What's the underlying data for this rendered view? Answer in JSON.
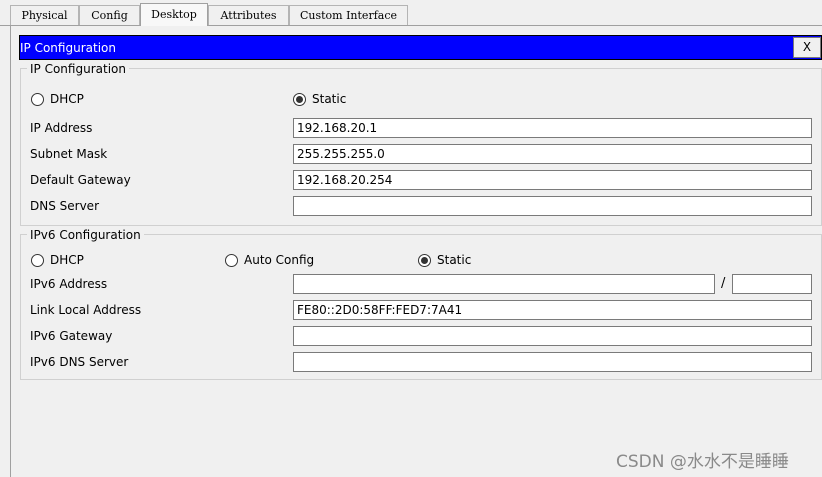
{
  "tabs": [
    {
      "label": "Physical"
    },
    {
      "label": "Config"
    },
    {
      "label": "Desktop",
      "active": true
    },
    {
      "label": "Attributes"
    },
    {
      "label": "Custom Interface"
    }
  ],
  "window": {
    "title": "IP Configuration",
    "close_label": "X",
    "titlebar_color": "#0000ff"
  },
  "ipv4": {
    "legend": "IP Configuration",
    "mode_dhcp": "DHCP",
    "mode_static": "Static",
    "selected_mode": "Static",
    "ip_label": "IP Address",
    "ip_value": "192.168.20.1",
    "mask_label": "Subnet Mask",
    "mask_value": "255.255.255.0",
    "gateway_label": "Default Gateway",
    "gateway_value": "192.168.20.254",
    "dns_label": "DNS Server",
    "dns_value": ""
  },
  "ipv6": {
    "legend": "IPv6 Configuration",
    "mode_dhcp": "DHCP",
    "mode_auto": "Auto Config",
    "mode_static": "Static",
    "selected_mode": "Static",
    "address_label": "IPv6 Address",
    "address_value": "",
    "prefix_separator": "/",
    "prefix_value": "",
    "link_local_label": "Link Local Address",
    "link_local_value": "FE80::2D0:58FF:FED7:7A41",
    "gateway_label": "IPv6 Gateway",
    "gateway_value": "",
    "dns_label": "IPv6 DNS Server",
    "dns_value": ""
  },
  "watermark": "CSDN @水水不是睡睡"
}
